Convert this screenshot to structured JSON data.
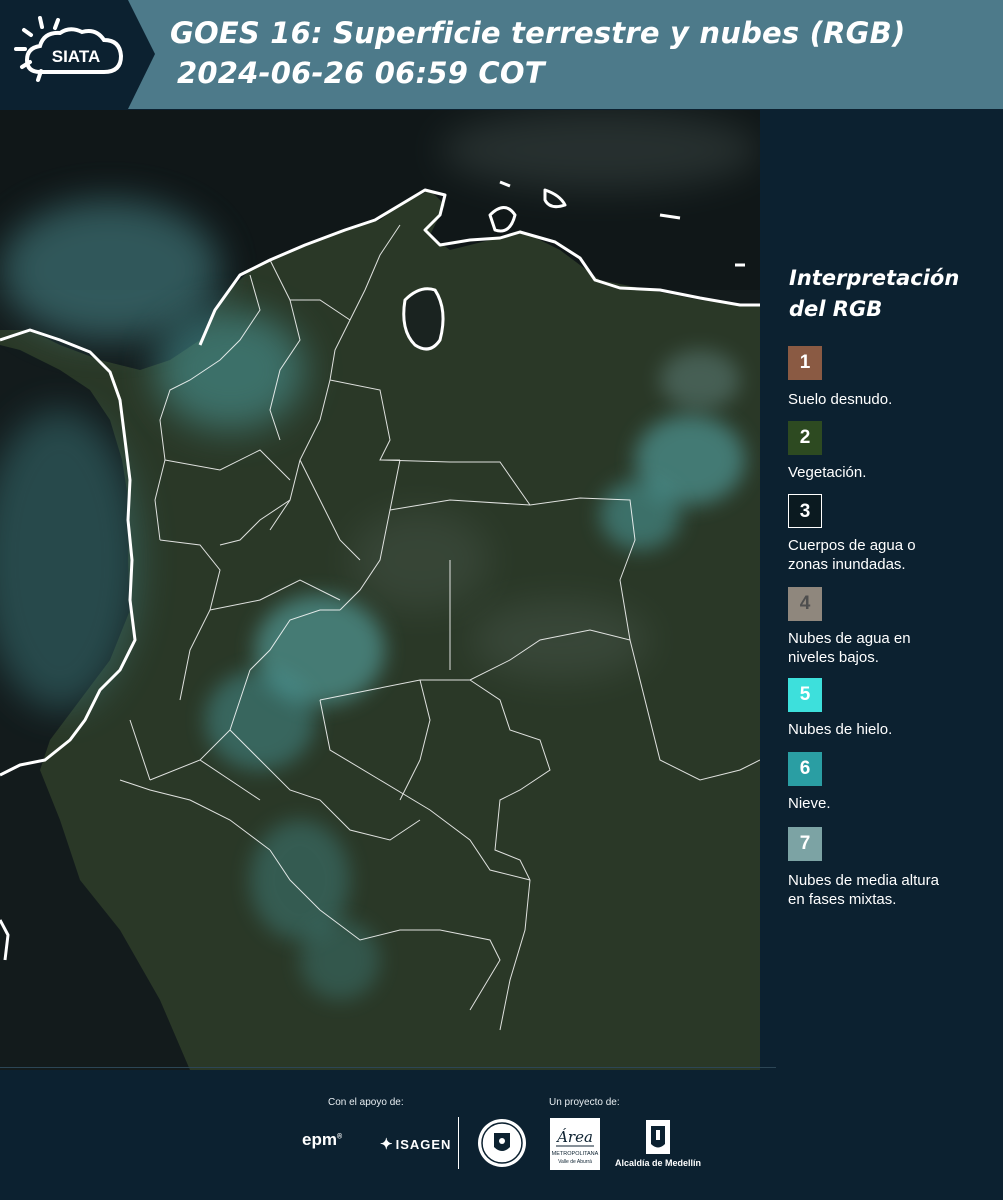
{
  "header": {
    "logo_text": "SIATA",
    "title_line1": "GOES 16: Superficie terrestre y nubes (RGB)",
    "title_line2": "2024-06-26 06:59 COT"
  },
  "legend": {
    "title_line1": "Interpretación",
    "title_line2": "del RGB",
    "items": [
      {
        "number": "1",
        "label_lines": [
          "Suelo desnudo."
        ],
        "color": "#8a5a43",
        "text_color": "#ffffff"
      },
      {
        "number": "2",
        "label_lines": [
          "Vegetación."
        ],
        "color": "#2d4a21",
        "text_color": "#ffffff"
      },
      {
        "number": "3",
        "label_lines": [
          "Cuerpos de agua o",
          "zonas inundadas."
        ],
        "color": "#0b1a20",
        "text_color": "#ffffff"
      },
      {
        "number": "4",
        "label_lines": [
          "Nubes de agua en",
          "niveles bajos."
        ],
        "color": "#8f877d",
        "text_color": "#4e4e4e"
      },
      {
        "number": "5",
        "label_lines": [
          "Nubes de hielo."
        ],
        "color": "#3de0dc",
        "text_color": "#ffffff"
      },
      {
        "number": "6",
        "label_lines": [
          "Nieve."
        ],
        "color": "#2a9ea3",
        "text_color": "#ffffff"
      },
      {
        "number": "7",
        "label_lines": [
          "Nubes de media altura",
          "en fases mixtas."
        ],
        "color": "#7ca3a4",
        "text_color": "#ffffff"
      }
    ]
  },
  "map": {
    "colors": {
      "land": "#2b3a26",
      "ocean": "#121a1b",
      "ice_cloud": "#4fa8aa",
      "low_cloud": "#6b7a74",
      "borders": "#ffffff"
    }
  },
  "footer": {
    "support_label": "Con el apoyo de:",
    "project_label": "Un proyecto de:",
    "sponsor1": "epm",
    "sponsor2": "ISAGEN",
    "partner_amva_line1": "METROPOLITANA",
    "partner_amva_line2": "Valle de Aburrá",
    "partner_amva_script": "Área",
    "partner_alcaldia": "Alcaldía de Medellín"
  }
}
